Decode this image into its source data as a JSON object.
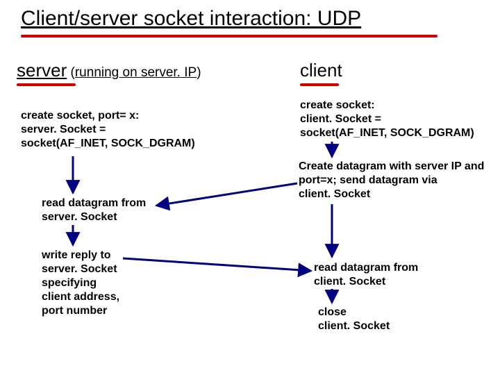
{
  "title": "Client/server socket interaction: UDP",
  "server_heading_main": "server",
  "server_heading_paren_open": " (",
  "server_heading_running_on": "running on ",
  "server_heading_serverip": "server. IP",
  "server_heading_paren_close": ")",
  "client_heading": "client",
  "srv_create_l1": "create socket, port= x:",
  "srv_create_l2": "server. Socket =",
  "srv_create_l3": "socket(AF_INET, SOCK_DGRAM)",
  "srv_read_l1": "read datagram from",
  "srv_read_l2": "server. Socket",
  "srv_write_l1": "write reply to",
  "srv_write_l2": "server. Socket",
  "srv_write_l3": "specifying",
  "srv_write_l4": "client address,",
  "srv_write_l5": "port number",
  "cli_create_l1": "create socket:",
  "cli_create_l2": "client. Socket =",
  "cli_create_l3": "socket(AF_INET, SOCK_DGRAM)",
  "cli_send_l1": "Create datagram with server IP and",
  "cli_send_l2": "port=x; send datagram via",
  "cli_send_l3": "client. Socket",
  "cli_read_l1": "read datagram from",
  "cli_read_l2": "client. Socket",
  "cli_close_l1": "close",
  "cli_close_l2": "client. Socket",
  "colors": {
    "accent": "#d00000",
    "arrow": "#000080"
  }
}
